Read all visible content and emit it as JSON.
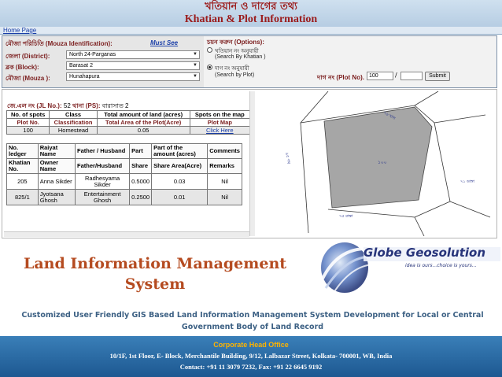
{
  "header": {
    "title_bn": "খতিয়ান ও দাগের তথ্য",
    "title_en": "Khatian & Plot Information",
    "home_link": "Home Page"
  },
  "form": {
    "mouza_label": "মৌজা পরিচিতি (Mouza Identification):",
    "must_see": "Must See",
    "district_label": "জেলা (District):",
    "district_value": "North 24-Parganas",
    "block_label": "ব্লক (Block):",
    "block_value": "Barasat 2",
    "mouza_field_label": "মৌজা (Mouza ):",
    "mouza_value": "Hunahapura",
    "options_label": "চয়ন করুন (Options):",
    "option1_bn": "খতিয়ান নং অনুযায়ী",
    "option1_en": "(Search By Khatian )",
    "option2_bn": "দাগ নং অনুযায়ী",
    "option2_en": "(Search by Plot)",
    "selected_option": "Search by Plot",
    "plot_label": "দাগ নং (Plot No).",
    "plot_value": "100",
    "plot_sub_value": "",
    "submit_label": "Submit"
  },
  "result": {
    "jl_label": "জে.এল নং (JL No.):",
    "jl_value": "52",
    "ps_label": "থানা (PS):",
    "ps_value": "বারাসাত 2",
    "summary": {
      "headers": [
        "No. of spots",
        "Class",
        "Total amount of land (acres)",
        "Spots on the map"
      ],
      "subheaders": [
        "Plot No.",
        "Classification",
        "Total Area of the Plot(Acre)",
        "Plot Map"
      ],
      "row": [
        "100",
        "Homestead",
        "0.05",
        "Click Here"
      ]
    },
    "owners": {
      "headers_top": [
        "No. ledger",
        "Raiyat Name",
        "Father / Husband",
        "Part",
        "Part of the amount (acres)",
        "Comments"
      ],
      "headers_bottom": [
        "Khatian No.",
        "Owner Name",
        "Father/Husband",
        "Share",
        "Share Area(Acre)",
        "Remarks"
      ],
      "rows": [
        [
          "205",
          "Anna Sikder",
          "Radhesyama Sikder",
          "0.5000",
          "0.03",
          "Nil"
        ],
        [
          "825/1",
          "Jyotsana Ghosh",
          "Entertainment Ghosh",
          "0.2500",
          "0.01",
          "Nil"
        ]
      ]
    }
  },
  "map": {
    "plot_label": "১০০",
    "neighbor_labels": [
      "৭৬ খাল",
      "৯৫ পথ",
      "৭১ ডাঙ্গা",
      "৭৫ রাস্তা"
    ],
    "plot_fill": "#a6a6a6"
  },
  "promo": {
    "title": "Land Information Management System",
    "brand": "Globe Geosolution",
    "tagline": "idea is ours...choice is yours...",
    "description": "Customized User Friendly GIS Based Land Information Management System Development for Local or Central Government Body of Land Record"
  },
  "footer": {
    "heading": "Corporate Head Office",
    "address": "10/1F, 1st Floor, E- Block, Merchantile Building, 9/12, Lalbazar Street, Kolkata- 700001, WB, India",
    "contact": "Contact: +91 11 3079 7232, Fax: +91 22 6645 9192"
  },
  "colors": {
    "header_text": "#9b1c1c",
    "label_text": "#7b1e1e",
    "link": "#1a3ea8",
    "promo_title": "#b54b20",
    "brand": "#27347a",
    "description": "#3d6184",
    "footer_bg": "#2a6aa4",
    "footer_heading": "#ffb400"
  }
}
